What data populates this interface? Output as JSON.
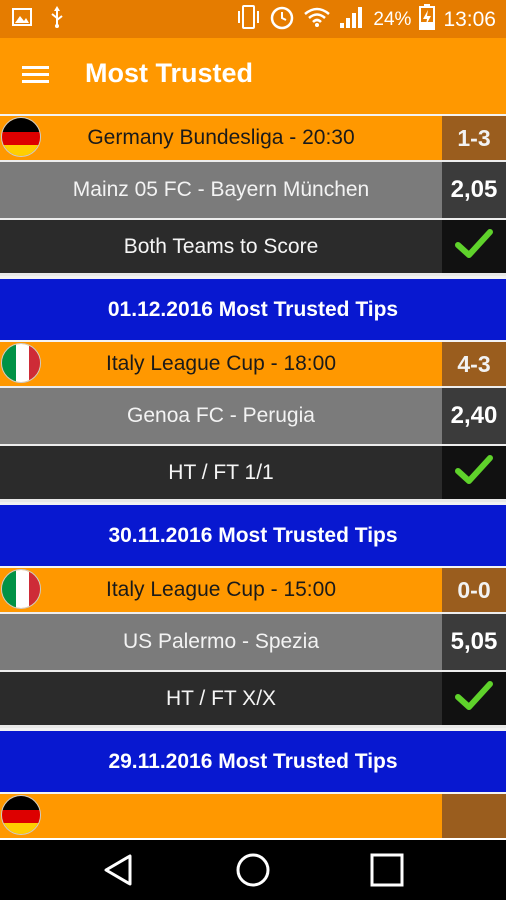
{
  "status_bar": {
    "battery": "24%",
    "time": "13:06"
  },
  "app_bar": {
    "title": "Most Trusted"
  },
  "colors": {
    "status_bar": "#e57c00",
    "app_bar": "#ff9800",
    "league_row": "#ff9800",
    "score_cell": "#9a5d1e",
    "match_row": "#7b7b7b",
    "tip_row": "#2b2b2b",
    "section_header": "#0818d0",
    "check": "#5fd22b"
  },
  "cards": [
    {
      "league": "Germany Bundesliga - 20:30",
      "flag": "germany-flag-icon",
      "score": "1-3",
      "match": "Mainz 05 FC - Bayern München",
      "odds": "2,05",
      "tip": "Both Teams to Score",
      "result_icon": "check-icon"
    },
    {
      "header": "01.12.2016 Most Trusted Tips",
      "league": "Italy League Cup - 18:00",
      "flag": "italy-flag-icon",
      "score": "4-3",
      "match": "Genoa FC - Perugia",
      "odds": "2,40",
      "tip": "HT / FT 1/1",
      "result_icon": "check-icon"
    },
    {
      "header": "30.11.2016 Most Trusted Tips",
      "league": "Italy League Cup - 15:00",
      "flag": "italy-flag-icon",
      "score": "0-0",
      "match": "US Palermo - Spezia",
      "odds": "5,05",
      "tip": "HT / FT X/X",
      "result_icon": "check-icon"
    },
    {
      "header": "29.11.2016 Most Trusted Tips"
    }
  ]
}
